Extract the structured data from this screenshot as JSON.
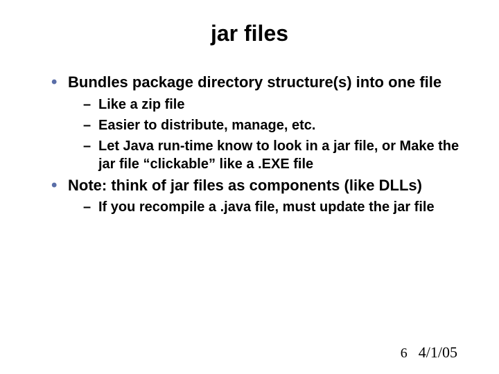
{
  "title": "jar files",
  "bullets": [
    {
      "text": "Bundles package directory structure(s) into one file",
      "sub": [
        "Like a zip file",
        "Easier to distribute, manage, etc.",
        "Let Java run-time know to look in a jar file, or Make the jar file “clickable” like a .EXE file"
      ]
    },
    {
      "text": "Note: think of jar files as components (like DLLs)",
      "sub": [
        "If you recompile a .java file, must update the jar file"
      ]
    }
  ],
  "footer": {
    "page": "6",
    "date": "4/1/05"
  }
}
